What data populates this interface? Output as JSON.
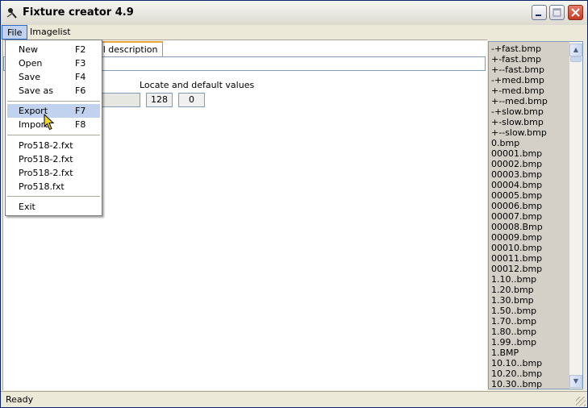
{
  "window": {
    "title": "Fixture creator 4.9"
  },
  "menubar": {
    "file": "File",
    "imagelist": "Imagelist"
  },
  "file_menu": {
    "items": [
      {
        "label": "New",
        "shortcut": "F2"
      },
      {
        "label": "Open",
        "shortcut": "F3"
      },
      {
        "label": "Save",
        "shortcut": "F4"
      },
      {
        "label": "Save as",
        "shortcut": "F6"
      }
    ],
    "export": {
      "label": "Export",
      "shortcut": "F7"
    },
    "import": {
      "label": "Import",
      "shortcut": "F8"
    },
    "recent": [
      "Pro518-2.fxt",
      "Pro518-2.fxt",
      "Pro518-2.fxt",
      "Pro518.fxt"
    ],
    "exit": "Exit"
  },
  "main": {
    "tab_label": "al description",
    "locate_label": "Locate and default values",
    "value1": "128",
    "value2": "0"
  },
  "image_list": [
    "-+fast.bmp",
    "+-fast.bmp",
    "+--fast.bmp",
    "-+med.bmp",
    "+-med.bmp",
    "+--med.bmp",
    "-+slow.bmp",
    "+-slow.bmp",
    "+--slow.bmp",
    "0.bmp",
    "00001.bmp",
    "00002.bmp",
    "00003.bmp",
    "00004.bmp",
    "00005.bmp",
    "00006.bmp",
    "00007.bmp",
    "00008.Bmp",
    "00009.bmp",
    "00010.bmp",
    "00011.bmp",
    "00012.bmp",
    "1.10..bmp",
    "1.20.bmp",
    "1.30.bmp",
    "1.50..bmp",
    "1.70..bmp",
    "1.80..bmp",
    "1.99..bmp",
    "1.BMP",
    "10.10..bmp",
    "10.20..bmp",
    "10.30..bmp"
  ],
  "status": {
    "text": "Ready"
  },
  "icons": {
    "app": "fixture-app-icon",
    "minimize": "minimize-icon",
    "maximize": "maximize-icon",
    "close": "close-icon",
    "scroll_up": "arrow-up-icon",
    "scroll_down": "arrow-down-icon",
    "cursor": "pointer-cursor-icon"
  }
}
